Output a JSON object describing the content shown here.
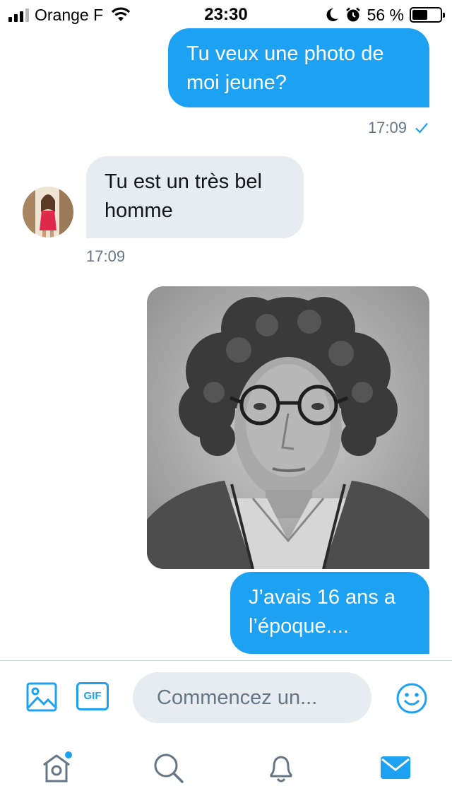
{
  "status_bar": {
    "carrier": "Orange F",
    "time": "23:30",
    "battery_percent": "56 %",
    "battery_level": 0.56,
    "signal_bars_active": 3,
    "signal_bars_total": 4,
    "icons": [
      "signal-icon",
      "wifi-icon",
      "moon-icon",
      "alarm-icon",
      "battery-icon"
    ]
  },
  "conversation": {
    "messages": [
      {
        "direction": "sent",
        "type": "text",
        "text": "Tu veux une photo de moi jeune?",
        "time": "17:09",
        "read": true
      },
      {
        "direction": "received",
        "type": "text",
        "text": "Tu est un très bel homme",
        "time": "17:09"
      },
      {
        "direction": "sent",
        "type": "image",
        "description_icon": "photo-message"
      },
      {
        "direction": "sent",
        "type": "text",
        "text": "J’avais 16 ans a l’époque...."
      }
    ]
  },
  "composer": {
    "gif_label": "GIF",
    "placeholder": "Commencez un...",
    "icons": [
      "image-icon",
      "gif-icon",
      "emoji-icon"
    ]
  },
  "tab_bar": {
    "tabs": [
      "home",
      "search",
      "notifications",
      "messages"
    ],
    "active_tab": "messages",
    "home_has_notification_dot": true
  },
  "colors": {
    "accent": "#1da1f2",
    "received_bubble": "#e6ecf0",
    "secondary_text": "#657786",
    "inactive_icon": "#657786",
    "divider": "#ccd6dd"
  }
}
